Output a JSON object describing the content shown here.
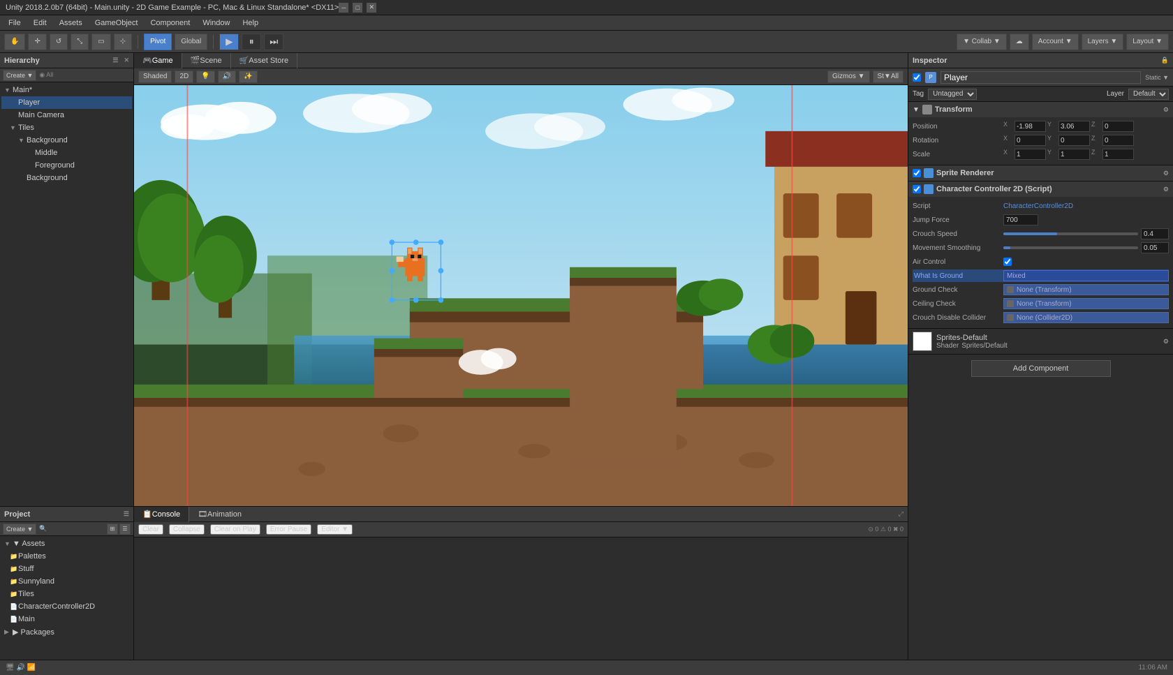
{
  "titlebar": {
    "title": "Unity 2018.2.0b7 (64bit) - Main.unity - 2D Game Example - PC, Mac & Linux Standalone* <DX11>",
    "min_label": "─",
    "max_label": "□",
    "close_label": "✕"
  },
  "menubar": {
    "items": [
      "File",
      "Edit",
      "Assets",
      "GameObject",
      "Component",
      "Window",
      "Help"
    ]
  },
  "toolbar": {
    "pivot_label": "Pivot",
    "global_label": "Global",
    "collab_label": "▼ Collab ▼",
    "account_label": "Account ▼",
    "layers_label": "Layers ▼",
    "layout_label": "Layout ▼"
  },
  "hierarchy": {
    "title": "Hierarchy",
    "create_label": "Create ▼",
    "all_label": "◉ All",
    "items": [
      {
        "label": "▼ Main*",
        "indent": 0,
        "selected": false
      },
      {
        "label": "Player",
        "indent": 1,
        "selected": true
      },
      {
        "label": "Main Camera",
        "indent": 1,
        "selected": false
      },
      {
        "label": "▼ Tiles",
        "indent": 1,
        "selected": false
      },
      {
        "label": "▼ Background",
        "indent": 2,
        "selected": false
      },
      {
        "label": "Middle",
        "indent": 3,
        "selected": false
      },
      {
        "label": "Foreground",
        "indent": 3,
        "selected": false
      },
      {
        "label": "Background",
        "indent": 2,
        "selected": false
      }
    ]
  },
  "views": {
    "tabs": [
      "Game",
      "Scene",
      "Asset Store"
    ],
    "active_tab": "Game",
    "shaded_label": "Shaded",
    "twod_label": "2D",
    "gizmos_label": "Gizmos ▼",
    "st_all_label": "St▼All"
  },
  "inspector": {
    "title": "Inspector",
    "static_label": "Static ▼",
    "obj_name": "Player",
    "tag_label": "Tag",
    "tag_value": "Untagged",
    "layer_label": "Layer",
    "layer_value": "Default",
    "transform": {
      "title": "Transform",
      "position_label": "Position",
      "pos_x": "-1.98",
      "pos_y": "3.06",
      "pos_z": "0",
      "rotation_label": "Rotation",
      "rot_x": "0",
      "rot_y": "0",
      "rot_z": "0",
      "scale_label": "Scale",
      "scale_x": "1",
      "scale_y": "1",
      "scale_z": "1"
    },
    "sprite_renderer": {
      "title": "Sprite Renderer"
    },
    "character_controller": {
      "title": "Character Controller 2D (Script)",
      "script_label": "Script",
      "script_value": "CharacterController2D",
      "jump_force_label": "Jump Force",
      "jump_force_value": "700",
      "crouch_speed_label": "Crouch Speed",
      "crouch_speed_value": "0.4",
      "movement_smoothing_label": "Movement Smoothing",
      "movement_smoothing_value": "0.05",
      "air_control_label": "Air Control",
      "what_is_ground_label": "What Is Ground",
      "what_is_ground_value": "Mixed",
      "ground_check_label": "Ground Check",
      "ground_check_value": "None (Transform)",
      "ceiling_check_label": "Ceiling Check",
      "ceiling_check_value": "None (Transform)",
      "crouch_disable_label": "Crouch Disable Collider",
      "crouch_disable_value": "None (Collider2D)"
    },
    "sprites_default": {
      "name": "Sprites-Default",
      "shader_label": "Shader",
      "shader_value": "Sprites/Default"
    },
    "add_component_label": "Add Component"
  },
  "project": {
    "title": "Project",
    "create_label": "Create ▼",
    "assets_label": "▼ Assets",
    "items": [
      "Palettes",
      "Stuff",
      "Sunnyland",
      "Tiles",
      "CharacterController2D",
      "Main"
    ],
    "packages_label": "▶ Packages"
  },
  "console": {
    "tabs": [
      "Console",
      "Animation"
    ],
    "active_tab": "Console",
    "clear_label": "Clear",
    "collapse_label": "Collapse",
    "clear_on_play_label": "Clear on Play",
    "error_pause_label": "Error Pause",
    "editor_label": "Editor ▼"
  },
  "statusbar": {
    "time": "11:06 AM"
  }
}
